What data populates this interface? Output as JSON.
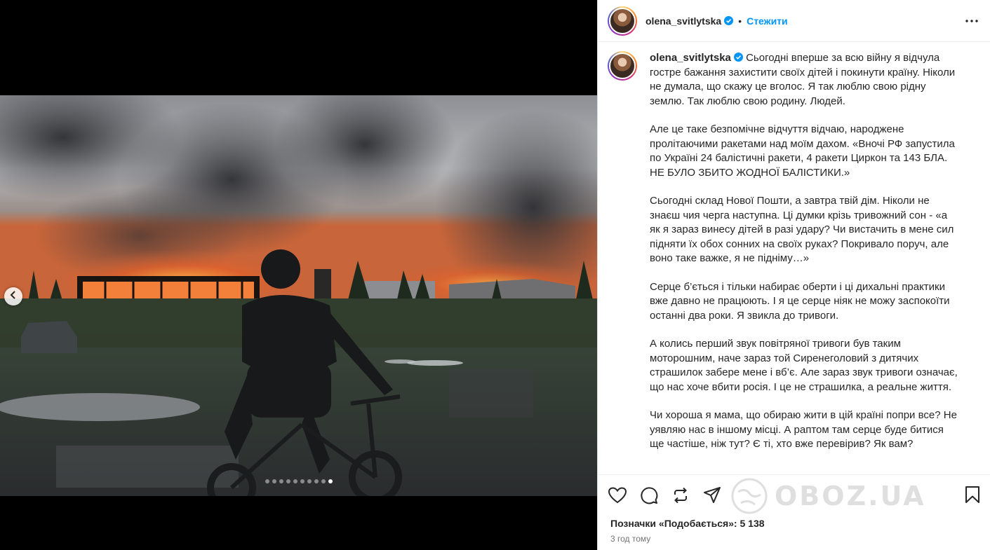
{
  "post": {
    "username": "olena_svitlytska",
    "follow_label": "Стежити",
    "separator": "•"
  },
  "caption": {
    "username": "olena_svitlytska",
    "paragraphs": [
      "Сьогодні вперше за всю війну я відчула гостре бажання захистити своїх дітей і покинути країну. Ніколи не думала, що скажу це вголос. Я так люблю свою рідну землю. Так люблю свою родину. Людей.",
      "Але це таке безпомічне відчуття відчаю, народжене пролітаючими ракетами над моїм дахом. «Вночі РФ запустила по Україні 24 балістичні ракети, 4 ракети Циркон та 143 БЛА. НЕ БУЛО ЗБИТО ЖОДНОЇ БАЛІСТИКИ.»",
      "Сьогодні склад Нової Пошти, а завтра твій дім. Ніколи не знаєш чия черга наступна. Ці думки крізь тривожний сон - «а як я зараз винесу дітей в разі удару? Чи вистачить в мене сил підняти їх обох сонних на своїх руках? Покривало поруч, але воно таке важке, я не підніму…»",
      "Серце б’ється і тільки набирає оберти і ці дихальні практики вже давно не працюють. І я це серце ніяк не можу заспокоїти останні два роки. Я звикла до тривоги.",
      "А колись перший звук повітряної тривоги був таким моторошним, наче зараз той Сиренеголовий з дитячих страшилок забере мене і вб’є. Але зараз звук тривоги означає, що нас хоче вбити росія. І це не страшилка, а реальне життя.",
      "Чи хороша я мама, що обираю жити в цій країні попри все? Не уявляю нас в іншому місці. А раптом там серце буде битися ще частіше, ніж тут? Є ті, хто вже перевірив? Як вам?"
    ]
  },
  "stats": {
    "likes": "Позначки «Подобається»: 5 138",
    "time": "3 год тому"
  },
  "watermark": "OBOZ.UA",
  "carousel": {
    "total": 10,
    "active": 9
  },
  "icons": [
    "chevron-left-icon",
    "more-icon",
    "heart-icon",
    "comment-icon",
    "repost-icon",
    "share-icon",
    "bookmark-icon",
    "verified-icon"
  ],
  "colors": {
    "accent": "#0095f6",
    "verified": "#0095f6",
    "text": "#262626",
    "muted": "#737373"
  }
}
